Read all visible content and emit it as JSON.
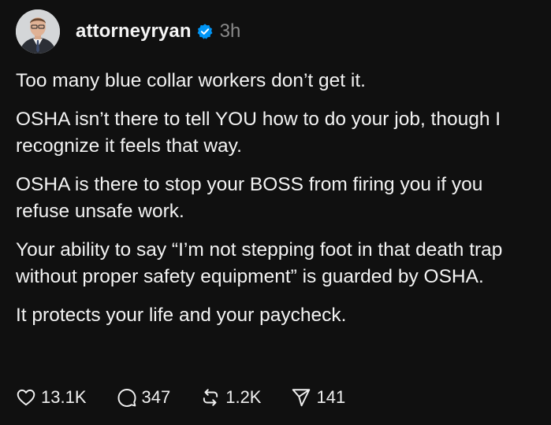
{
  "post": {
    "username": "attorneyryan",
    "time": "3h",
    "paragraphs": [
      "Too many blue collar workers don’t get it.",
      "OSHA isn’t there to tell YOU how to do your job, though I recognize it feels that way.",
      "OSHA is there to stop your BOSS from firing you if you refuse unsafe work.",
      "Your ability to say “I’m not stepping foot in that death trap without proper safety equipment” is guarded by OSHA.",
      "It protects your life and your paycheck."
    ]
  },
  "actions": {
    "likes": "13.1K",
    "replies": "347",
    "reposts": "1.2K",
    "shares": "141"
  },
  "colors": {
    "background": "#101010",
    "text": "#f3f3f3",
    "muted": "#8a8a8a",
    "verified": "#0095f6"
  },
  "icons": [
    "verified-badge-icon",
    "heart-icon",
    "comment-icon",
    "repost-icon",
    "share-icon"
  ]
}
